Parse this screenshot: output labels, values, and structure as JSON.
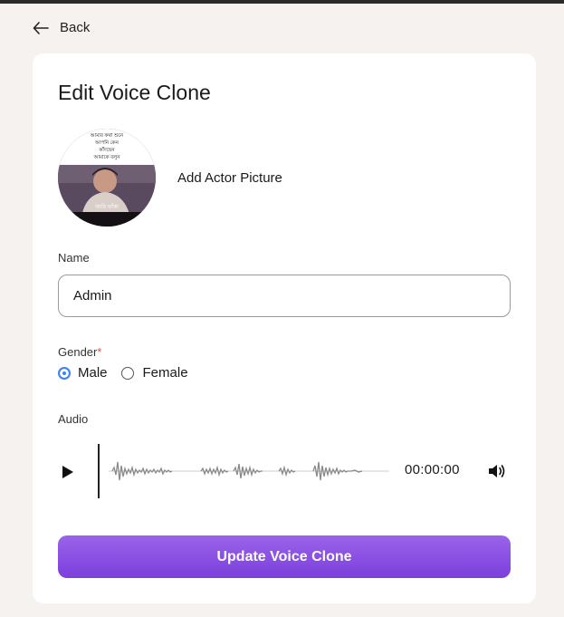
{
  "nav": {
    "back_label": "Back",
    "back_icon": "arrow-left-icon"
  },
  "form": {
    "title": "Edit Voice Clone",
    "avatar": {
      "caption": "Add Actor Picture",
      "image_text_lines": [
        "আমার কথা শুনে",
        "আপনি কেন",
        "কাঁদছেন",
        "আমাকে বলুন"
      ],
      "image_subtitle": "আমি ফাঁকা"
    },
    "name": {
      "label": "Name",
      "value": "Admin"
    },
    "gender": {
      "label": "Gender",
      "required_mark": "*",
      "options": [
        {
          "label": "Male",
          "selected": true
        },
        {
          "label": "Female",
          "selected": false
        }
      ]
    },
    "audio": {
      "label": "Audio",
      "time": "00:00:00",
      "play_icon": "play-icon",
      "volume_icon": "volume-icon"
    },
    "submit_label": "Update Voice Clone"
  },
  "colors": {
    "accent": "#3b82f6",
    "button_top": "#9a63ea",
    "button_bottom": "#7c3fdc",
    "required": "#e24c4c",
    "background": "#f5f2f0"
  }
}
